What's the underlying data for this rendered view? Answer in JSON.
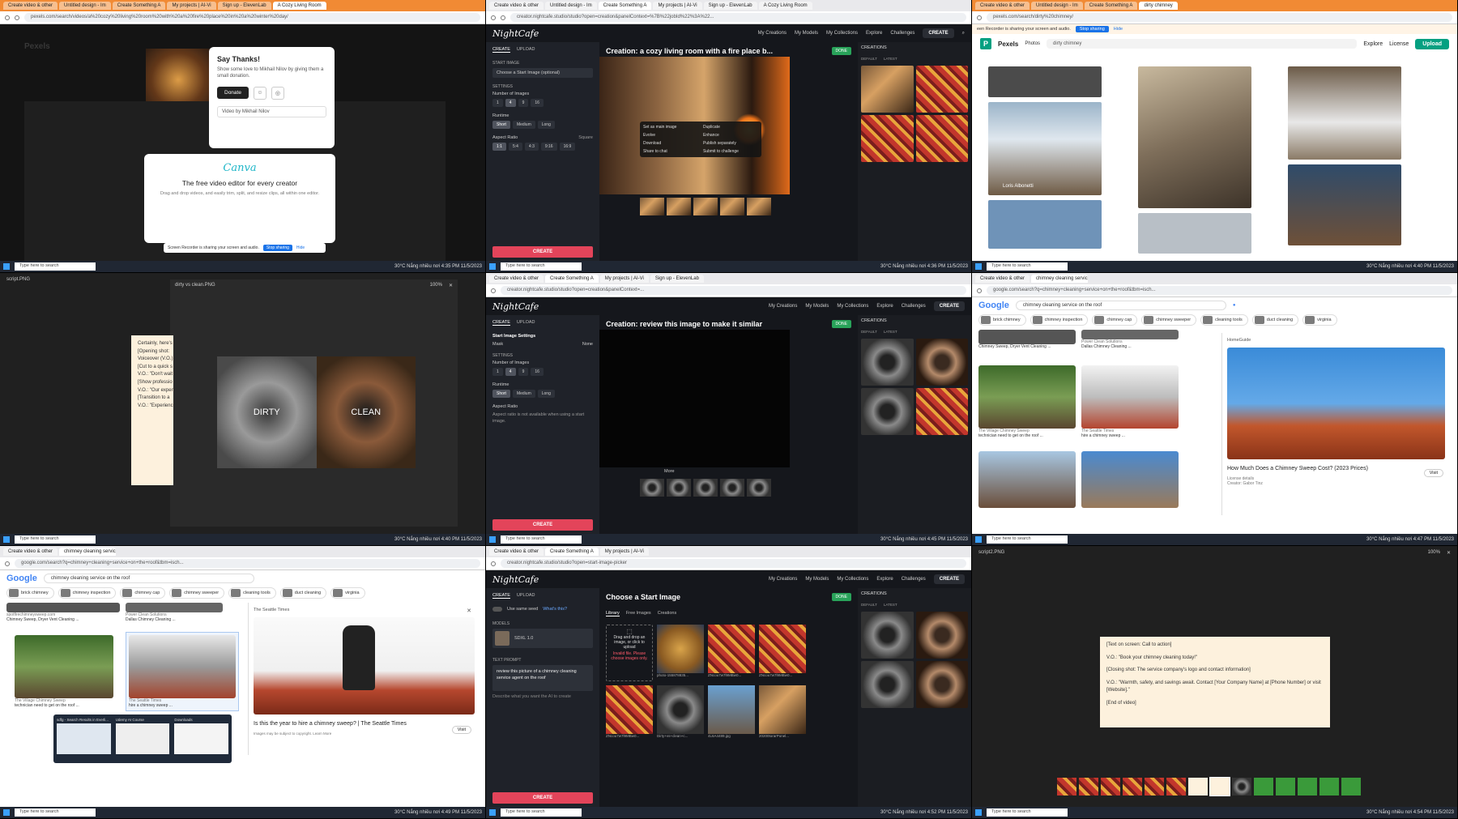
{
  "p1": {
    "tabs": [
      "Create video & other",
      "Untitled design - Im",
      "Create Something A",
      "My projects | AI-Vi",
      "Sign up - ElevenLab",
      "A Cozy Living Room"
    ],
    "url": "pexels.com/search/videos/a%20cozy%20living%20room%20with%20a%20fire%20place%20in%20a%20winter%20day/",
    "share_text": "Screen Recorder is sharing your screen and audio.",
    "share_btn": "Stop sharing",
    "share_hide": "Hide",
    "say_thanks": "Say Thanks!",
    "donation_text": "Show some love to Mikhail Nilov by giving them a small donation.",
    "donate": "Donate",
    "video_by": "Video by Mikhail Nilov",
    "canva_logo": "Canva",
    "canva_headline": "The free video editor for every creator",
    "canva_sub": "Drag and drop videos, and easily trim, split, and resize clips, all within one editor.",
    "pexels": "Pexels",
    "taskbar_search": "Type here to search",
    "tray": "30°C Nắng nhiều nơi  4:35 PM 11/5/2023"
  },
  "p2": {
    "tabs": [
      "Create video & other",
      "Untitled design - Im",
      "Create Something A",
      "My projects | AI-Vi",
      "Sign up - ElevenLab",
      "A Cozy Living Room"
    ],
    "url": "creator.nightcafe.studio/studio?open=creation&panelContext=%7B%22jobId%22%3A%22...",
    "logo": "NightCafe",
    "nav": [
      "My Creations",
      "My Models",
      "My Collections",
      "Explore",
      "Challenges"
    ],
    "create_btn": "CREATE",
    "title": "Creation: a cozy living room with a fire place b...",
    "done": "DONE",
    "side_tabs": [
      "CREATE",
      "UPLOAD"
    ],
    "start_image": "START IMAGE",
    "start_image_choose": "Choose a Start Image (optional)",
    "settings": "SETTINGS",
    "num_images": "Number of Images",
    "num_options": [
      "1",
      "4",
      "9",
      "16"
    ],
    "runtime": "Runtime",
    "runtime_options": [
      "Short",
      "Medium",
      "Long"
    ],
    "aspect": "Aspect Ratio",
    "aspect_value": "Square",
    "aspect_options": [
      "1:1",
      "5:4",
      "4:3",
      "9:16",
      "16:9"
    ],
    "cta": "CREATE",
    "ctx": [
      "Set as main image",
      "Duplicate",
      "Evolve",
      "Enhance",
      "Download",
      "Publish separately",
      "Share to chat",
      "Submit to challenge"
    ],
    "creations": "CREATIONS",
    "default": "DEFAULT",
    "latest": "LATEST",
    "tray": "30°C Nắng nhiều nơi  4:36 PM 11/5/2023"
  },
  "p3": {
    "url": "pexels.com/search/dirty%20chimney/",
    "share_text": "een Recorder is sharing your screen and audio.",
    "logo_text": "Pexels",
    "photos": "Photos",
    "search": "dirty chimney",
    "explore": "Explore",
    "license": "License",
    "upload": "Upload",
    "credit": "Loris Albonetti",
    "tray": "30°C Nắng nhiều nơi  4:40 PM 11/5/2023"
  },
  "p4": {
    "file": "script.PNG",
    "file2": "dirty vs clean.PNG",
    "zoom": "100%",
    "dirty": "DIRTY",
    "clean": "CLEAN",
    "notes": [
      "Certainly, here's",
      "[Opening shot:",
      "Voiceover (V.O.)",
      "[Cut to a quick s",
      "V.O.: \"Don't wait",
      "[Show professio",
      "V.O.: \"Our expert",
      "[Transition to a",
      "V.O.: \"Experienc"
    ],
    "tray": "30°C Nắng nhiều nơi  4:40 PM 11/5/2023"
  },
  "p5": {
    "url": "creator.nightcafe.studio/studio?open=creation&panelContext=...",
    "logo": "NightCafe",
    "nav": [
      "My Creations",
      "My Models",
      "My Collections",
      "Explore",
      "Challenges"
    ],
    "create_btn": "CREATE",
    "title": "Creation: review this image to make it similar",
    "done": "DONE",
    "side_tabs": [
      "CREATE",
      "UPLOAD"
    ],
    "start_settings": "Start Image Settings",
    "mask": "Mask",
    "mask_val": "None",
    "settings": "SETTINGS",
    "num_images": "Number of Images",
    "num_options": [
      "1",
      "4",
      "9",
      "16"
    ],
    "runtime": "Runtime",
    "runtime_options": [
      "Short",
      "Medium",
      "Long"
    ],
    "aspect": "Aspect Ratio",
    "aspect_note": "Aspect ratio is not available when using a start image.",
    "cta": "CREATE",
    "more": "More",
    "creations": "CREATIONS",
    "default": "DEFAULT",
    "latest": "LATEST",
    "tray": "30°C Nắng nhiều nơi  4:45 PM 11/5/2023"
  },
  "p6": {
    "url": "google.com/search?q=chimney+cleaning+service+on+the+roof&tbm=isch...",
    "logo": "Google",
    "search": "chimney cleaning service on the roof",
    "chips": [
      "brick chimney",
      "chimney inspection",
      "chimney cap",
      "chimney sweeper",
      "cleaning tools",
      "duct cleaning",
      "virginia"
    ],
    "r1_title": "Chimney Sweep, Dryer Vent Cleaning ...",
    "r2_src": "Power Clean Solutions",
    "r2_title": "Dallas Chimney Cleaning ...",
    "r3_src": "The Village Chimney Sweep",
    "r3_title": "technician need to get on the roof ...",
    "r4_src": "The Seattle Times",
    "r4_title": "hire a chimney sweep ...",
    "preview_src": "HomeGuide",
    "preview_title": "How Much Does a Chimney Sweep Cost? (2023 Prices)",
    "visit": "Visit",
    "license": "License details",
    "credit": "Creator: Gabor Tinz",
    "tray": "30°C Nắng nhiều nơi  4:47 PM 11/5/2023"
  },
  "p7": {
    "url": "google.com/search?q=chimney+cleaning+service+on+the+roof&tbm=isch...",
    "logo": "Google",
    "search": "chimney cleaning service on the roof",
    "chips": [
      "brick chimney",
      "chimney inspection",
      "chimney cap",
      "chimney sweeper",
      "cleaning tools",
      "duct cleaning",
      "virginia"
    ],
    "r1_src": "spotfirechimneysweep.com",
    "r1_title": "Chimney Sweep, Dryer Vent Cleaning ...",
    "r2_src": "Power Clean Solutions",
    "r2_title": "Dallas Chimney Cleaning ...",
    "r3_src": "The Village Chimney Sweep",
    "r3_title": "technician need to get on the roof ...",
    "r4_src": "The Seattle Times",
    "r4_title": "hire a chimney sweep ...",
    "preview_src": "The Seattle Times",
    "preview_title": "Is this the year to hire a chimney sweep? | The Seattle Times",
    "visit": "Visit",
    "copyright": "Images may be subject to copyright. Learn More",
    "thumbs": [
      "sdfg - Search Results in Everli...",
      "Udemy AI Course",
      "Downloads"
    ],
    "tray": "30°C Nắng nhiều nơi  4:49 PM 11/5/2023"
  },
  "p8": {
    "url": "creator.nightcafe.studio/studio?open=start-image-picker",
    "logo": "NightCafe",
    "nav": [
      "My Creations",
      "My Models",
      "My Collections",
      "Explore",
      "Challenges"
    ],
    "create_btn": "CREATE",
    "title": "Choose a Start Image",
    "done": "DONE",
    "side_tabs": [
      "CREATE",
      "UPLOAD"
    ],
    "same_seed": "Use same seed",
    "whats_this": "What's this?",
    "models": "MODELS",
    "model": "SDXL 1.0",
    "text_prompt": "TEXT PROMPT",
    "prompt": "review this picture of a chimney cleaning service agent on the roof",
    "describe": "Describe what you want the AI to create",
    "cta": "CREATE",
    "lib_tabs": [
      "Library",
      "Free Images",
      "Creations"
    ],
    "drop": "Drag and drop an image, or click to upload",
    "invalid": "Invalid file. Please choose images only.",
    "img_names": [
      "photo-155878835...",
      "ZNcou7w7l9MBw0...",
      "ZNcou7w7l9MBw0...",
      "ZNcou7w7l9MBw0...",
      "Dirty+vs+clean+c...",
      "4L6A4489.jpg",
      "20200torarPonel..."
    ],
    "creations": "CREATIONS",
    "default": "DEFAULT",
    "latest": "LATEST",
    "tray": "30°C Nắng nhiều nơi  4:52 PM 11/5/2023"
  },
  "p9": {
    "file": "script2.PNG",
    "zoom": "100%",
    "lines": [
      "[Text on screen: Call to action]",
      "V.O.: \"Book your chimney cleaning today!\"",
      "[Closing shot: The service company's logo and contact information]",
      "V.O.: \"Warmth, safety, and savings await. Contact [Your Company Name] at [Phone Number] or visit [Website].\"",
      "[End of video]"
    ],
    "tray": "30°C Nắng nhiều nơi  4:54 PM 11/5/2023"
  }
}
